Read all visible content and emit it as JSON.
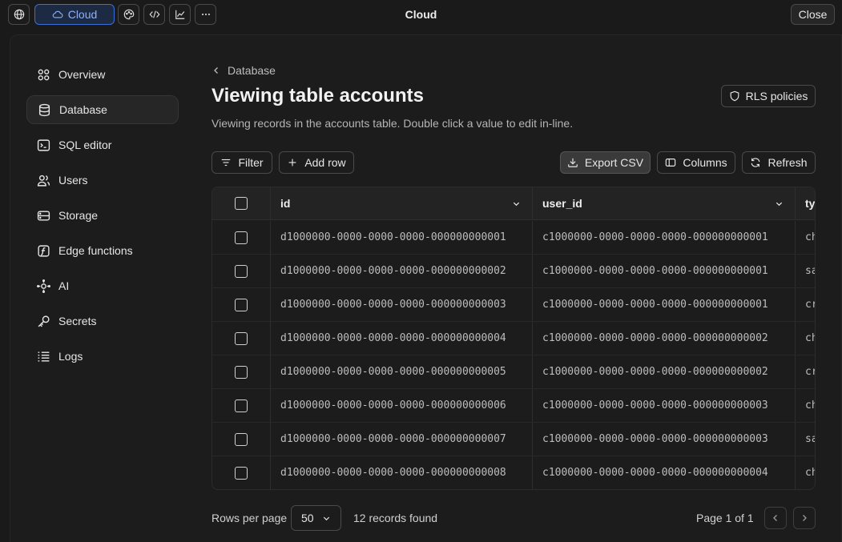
{
  "topbar": {
    "cloud_label": "Cloud",
    "title": "Cloud",
    "close_label": "Close",
    "icons": [
      "globe-icon",
      "cloud-icon",
      "palette-icon",
      "code-icon",
      "chart-icon",
      "more-icon"
    ]
  },
  "sidebar": {
    "items": [
      {
        "label": "Overview",
        "icon": "grid-icon",
        "active": false
      },
      {
        "label": "Database",
        "icon": "database-icon",
        "active": true
      },
      {
        "label": "SQL editor",
        "icon": "terminal-icon",
        "active": false
      },
      {
        "label": "Users",
        "icon": "users-icon",
        "active": false
      },
      {
        "label": "Storage",
        "icon": "storage-icon",
        "active": false
      },
      {
        "label": "Edge functions",
        "icon": "function-icon",
        "active": false
      },
      {
        "label": "AI",
        "icon": "ai-icon",
        "active": false
      },
      {
        "label": "Secrets",
        "icon": "key-icon",
        "active": false
      },
      {
        "label": "Logs",
        "icon": "list-icon",
        "active": false
      }
    ]
  },
  "main": {
    "breadcrumb": "Database",
    "title": "Viewing table accounts",
    "subtitle": "Viewing records in the accounts table. Double click a value to edit in-line.",
    "rls_label": "RLS policies",
    "toolbar": {
      "filter": "Filter",
      "add_row": "Add row",
      "export": "Export CSV",
      "columns": "Columns",
      "refresh": "Refresh"
    }
  },
  "table": {
    "columns": [
      "id",
      "user_id",
      "ty"
    ],
    "rows": [
      {
        "id": "d1000000-0000-0000-0000-000000000001",
        "user_id": "c1000000-0000-0000-0000-000000000001",
        "ty": "ch"
      },
      {
        "id": "d1000000-0000-0000-0000-000000000002",
        "user_id": "c1000000-0000-0000-0000-000000000001",
        "ty": "sa"
      },
      {
        "id": "d1000000-0000-0000-0000-000000000003",
        "user_id": "c1000000-0000-0000-0000-000000000001",
        "ty": "cr"
      },
      {
        "id": "d1000000-0000-0000-0000-000000000004",
        "user_id": "c1000000-0000-0000-0000-000000000002",
        "ty": "ch"
      },
      {
        "id": "d1000000-0000-0000-0000-000000000005",
        "user_id": "c1000000-0000-0000-0000-000000000002",
        "ty": "cr"
      },
      {
        "id": "d1000000-0000-0000-0000-000000000006",
        "user_id": "c1000000-0000-0000-0000-000000000003",
        "ty": "ch"
      },
      {
        "id": "d1000000-0000-0000-0000-000000000007",
        "user_id": "c1000000-0000-0000-0000-000000000003",
        "ty": "sa"
      },
      {
        "id": "d1000000-0000-0000-0000-000000000008",
        "user_id": "c1000000-0000-0000-0000-000000000004",
        "ty": "ch"
      }
    ]
  },
  "footer": {
    "rows_per_page_label": "Rows per page",
    "rows_per_page_value": "50",
    "records": "12 records found",
    "page": "Page 1 of 1"
  }
}
